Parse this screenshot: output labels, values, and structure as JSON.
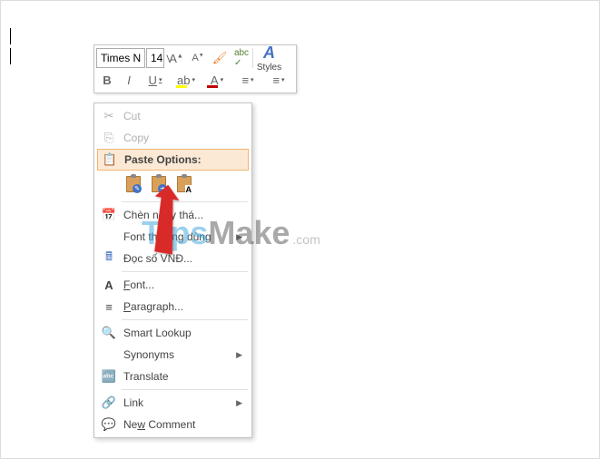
{
  "toolbar": {
    "font_name": "Times N",
    "font_size": "14",
    "styles_label": "Styles"
  },
  "context_menu": {
    "cut": "Cut",
    "copy": "Copy",
    "paste_options": "Paste Options:",
    "insert_date": "Chèn ngày thá...",
    "default_font": "Font thường dùng",
    "read_vnd": "Đọc số VNĐ...",
    "font": "Font...",
    "paragraph": "Paragraph...",
    "smart_lookup": "Smart Lookup",
    "synonyms": "Synonyms",
    "translate": "Translate",
    "link": "Link",
    "new_comment": "New Comment"
  },
  "watermark": {
    "tips": "Tips",
    "make": "Make",
    "com": ".com"
  }
}
